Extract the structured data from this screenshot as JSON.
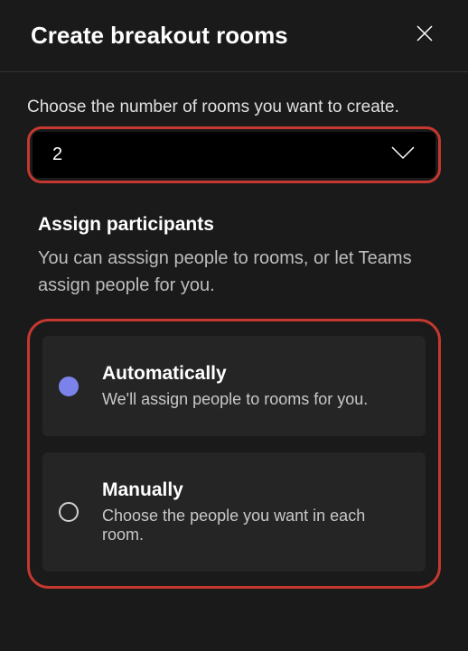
{
  "header": {
    "title": "Create breakout rooms"
  },
  "roomCount": {
    "prompt": "Choose the number of rooms you want to create.",
    "value": "2"
  },
  "assign": {
    "title": "Assign participants",
    "description": "You can asssign people to rooms, or let Teams assign people for you.",
    "options": [
      {
        "title": "Automatically",
        "description": "We'll assign people to rooms for you.",
        "selected": true
      },
      {
        "title": "Manually",
        "description": "Choose the people you want in each room.",
        "selected": false
      }
    ]
  }
}
